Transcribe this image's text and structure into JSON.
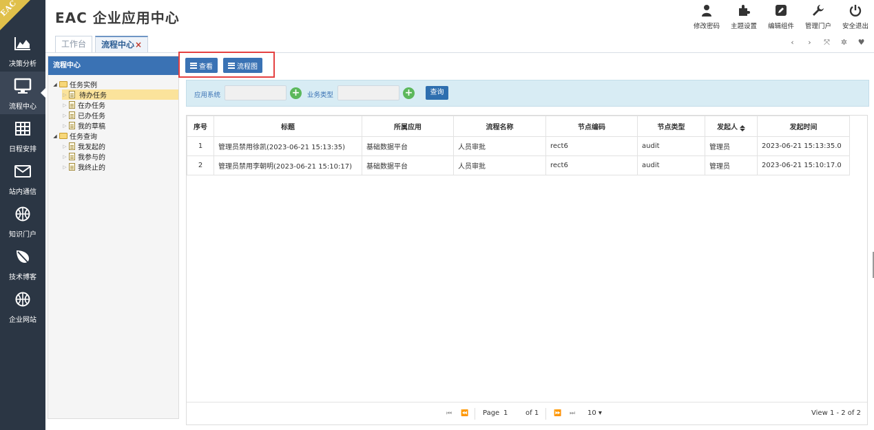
{
  "app": {
    "logo": "EAC",
    "title": "EAC 企业应用中心"
  },
  "sidebar": {
    "items": [
      {
        "label": "决策分析",
        "icon": "area-chart-icon"
      },
      {
        "label": "流程中心",
        "icon": "monitor-icon",
        "active": true
      },
      {
        "label": "日程安排",
        "icon": "table-icon"
      },
      {
        "label": "站内通信",
        "icon": "envelope-icon"
      },
      {
        "label": "知识门户",
        "icon": "basketball-icon"
      },
      {
        "label": "技术博客",
        "icon": "leaf-icon"
      },
      {
        "label": "企业网站",
        "icon": "basketball-icon"
      }
    ]
  },
  "top_actions": [
    {
      "label": "修改密码",
      "icon": "user-icon"
    },
    {
      "label": "主题设置",
      "icon": "puzzle-icon"
    },
    {
      "label": "编辑组件",
      "icon": "edit-icon"
    },
    {
      "label": "管理门户",
      "icon": "wrench-icon"
    },
    {
      "label": "安全退出",
      "icon": "power-icon"
    }
  ],
  "tabs": [
    {
      "label": "工作台"
    },
    {
      "label": "流程中心",
      "close": "×",
      "active": true
    }
  ],
  "mini_tools": [
    "‹",
    "›",
    "⤧",
    "✲",
    "♥"
  ],
  "tree": {
    "title": "流程中心",
    "nodes": [
      {
        "label": "任务实例",
        "type": "folder",
        "level": 0
      },
      {
        "label": "待办任务",
        "type": "file",
        "level": 1,
        "selected": true
      },
      {
        "label": "在办任务",
        "type": "file",
        "level": 1
      },
      {
        "label": "已办任务",
        "type": "file",
        "level": 1
      },
      {
        "label": "我的草稿",
        "type": "file",
        "level": 1
      },
      {
        "label": "任务查询",
        "type": "folder",
        "level": 0
      },
      {
        "label": "我发起的",
        "type": "file",
        "level": 1
      },
      {
        "label": "我参与的",
        "type": "file",
        "level": 1
      },
      {
        "label": "我终止的",
        "type": "file",
        "level": 1
      }
    ]
  },
  "toolbar": {
    "view_label": "查看",
    "flowchart_label": "流程图"
  },
  "search": {
    "app_system_label": "应用系统",
    "business_type_label": "业务类型",
    "query_label": "查询",
    "plus": "+"
  },
  "grid": {
    "columns": [
      "序号",
      "标题",
      "所属应用",
      "流程名称",
      "节点编码",
      "节点类型",
      "发起人",
      "发起时间"
    ],
    "rows": [
      [
        "1",
        "管理员禁用徐凯(2023-06-21 15:13:35)",
        "基础数据平台",
        "人员审批",
        "rect6",
        "audit",
        "管理员",
        "2023-06-21 15:13:35.0"
      ],
      [
        "2",
        "管理员禁用李朝明(2023-06-21 15:10:17)",
        "基础数据平台",
        "人员审批",
        "rect6",
        "audit",
        "管理员",
        "2023-06-21 15:10:17.0"
      ]
    ]
  },
  "pager": {
    "page_label": "Page",
    "page": "1",
    "of_label": "of 1",
    "page_size": "10",
    "view_text": "View 1 - 2 of 2"
  },
  "colors": {
    "sidebar": "#2b3644",
    "accent": "#3a72b4",
    "highlight_box": "#e43f3f",
    "search_bg": "#d8ecf4",
    "plus": "#5cb85c"
  }
}
